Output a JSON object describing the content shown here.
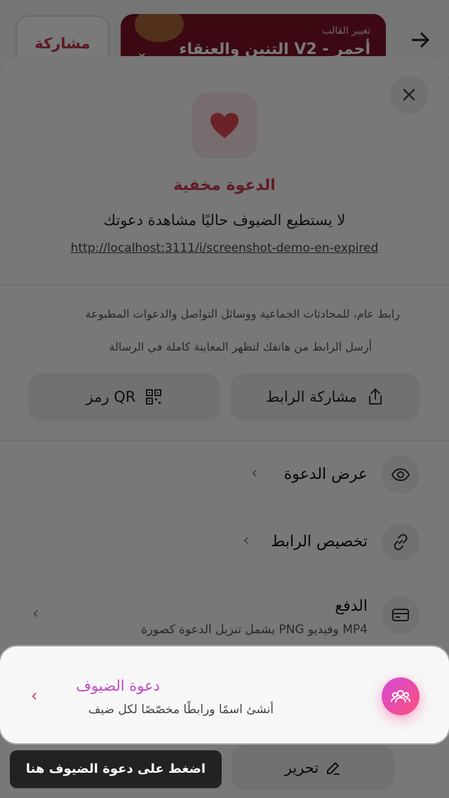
{
  "topbar": {
    "share_label": "مشاركة",
    "template_label": "تغيير القالب",
    "template_name": "التنين والعنقاء V2 - أحمر"
  },
  "sheet": {
    "status_title": "الدعوة مخفية",
    "status_subtitle": "لا يستطيع الضيوف حاليًا مشاهدة دعوتك",
    "url": "http://localhost:3111/i/screenshot-demo-en-expired",
    "info_line_1": "رابط عام، للمحادثات الجماعية ووسائل التواصل والدعوات المطبوعة",
    "info_line_2": "أرسل الرابط من هاتفك لتظهر المعاينة كاملة في الرسالة",
    "share_link_label": "مشاركة الرابط",
    "qr_label": "رمز QR",
    "rows": [
      {
        "title": "عرض الدعوة",
        "icon": "eye-icon"
      },
      {
        "title": "تخصيص الرابط",
        "icon": "link-icon"
      },
      {
        "title": "الدفع",
        "subtitle": "يشمل تنزيل الدعوة كصورة PNG وفيديو MP4",
        "icon": "card-icon"
      }
    ]
  },
  "guest_card": {
    "title": "دعوة الضيوف",
    "subtitle": "أنشئ اسمًا ورابطًا مخصّصًا لكل ضيف",
    "icon": "guests-icon"
  },
  "bottom": {
    "edit_label": "تحرير",
    "tooltip": "اضغط على دعوة الضيوف هنا"
  },
  "colors": {
    "accent": "#c9404f",
    "gradient_start": "#d24bd8",
    "gradient_end": "#ff4f7b"
  }
}
